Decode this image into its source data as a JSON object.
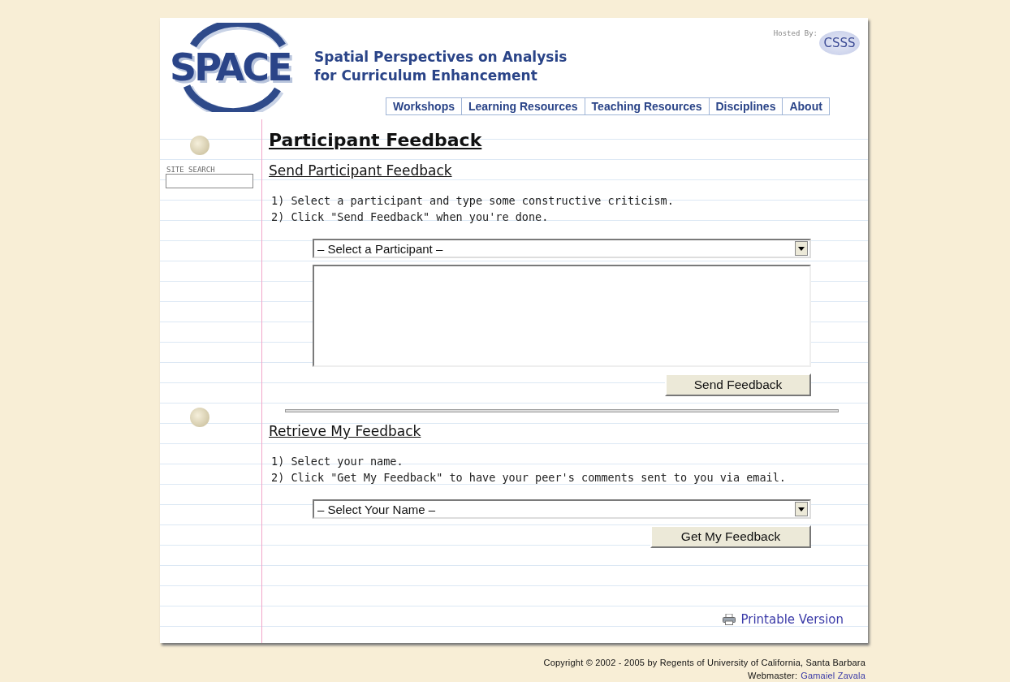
{
  "header": {
    "logo": "SPACE",
    "tagline_lines": [
      "Spatial Perspectives on Analysis",
      "for Curriculum Enhancement"
    ],
    "hosted_by": "Hosted By:",
    "host_logo": "CSSS"
  },
  "nav": [
    {
      "label": "Workshops"
    },
    {
      "label": "Learning Resources"
    },
    {
      "label": "Teaching Resources"
    },
    {
      "label": "Disciplines"
    },
    {
      "label": "About"
    }
  ],
  "sidebar": {
    "search_label": "SITE SEARCH"
  },
  "page_title": "Participant Feedback",
  "sections": [
    {
      "heading": "Send Participant Feedback",
      "steps": [
        "1) Select a participant and type some constructive criticism.",
        "2) Click \"Send Feedback\" when you're done."
      ],
      "select": "– Select a Participant –",
      "textarea": true,
      "button": "Send Feedback"
    },
    {
      "heading": "Retrieve My Feedback",
      "steps": [
        "1) Select your name.",
        "2) Click \"Get My Feedback\" to have your peer's comments sent to you via email."
      ],
      "select": "– Select Your Name –",
      "textarea": false,
      "button": "Get My Feedback"
    }
  ],
  "printable": "Printable Version",
  "footer": {
    "copyright": "Copyright © 2002 - 2005 by Regents of University of California, Santa Barbara",
    "webmaster_label": "Webmaster:",
    "webmaster_name": "Gamaiel Zavala"
  }
}
